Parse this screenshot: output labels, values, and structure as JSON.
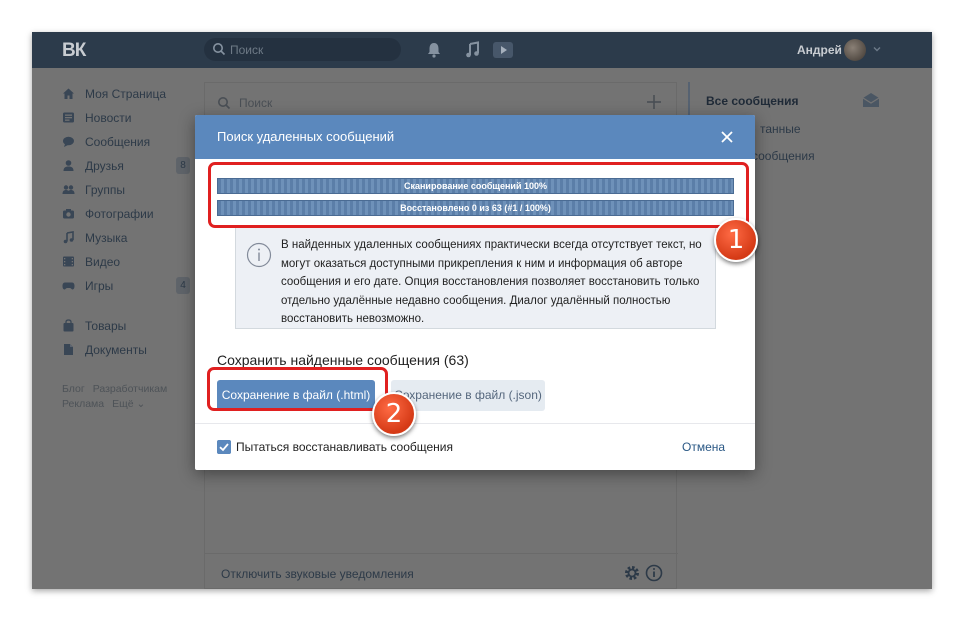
{
  "topbar": {
    "logo": "ВК",
    "search_placeholder": "Поиск",
    "user_name": "Андрей"
  },
  "sidebar": {
    "items": [
      {
        "label": "Моя Страница",
        "icon": "home-icon",
        "count": ""
      },
      {
        "label": "Новости",
        "icon": "news-icon",
        "count": ""
      },
      {
        "label": "Сообщения",
        "icon": "messages-icon",
        "count": ""
      },
      {
        "label": "Друзья",
        "icon": "friends-icon",
        "count": "8"
      },
      {
        "label": "Группы",
        "icon": "groups-icon",
        "count": ""
      },
      {
        "label": "Фотографии",
        "icon": "camera-icon",
        "count": ""
      },
      {
        "label": "Музыка",
        "icon": "music-icon",
        "count": ""
      },
      {
        "label": "Видео",
        "icon": "video-icon",
        "count": ""
      },
      {
        "label": "Игры",
        "icon": "gamepad-icon",
        "count": "4"
      }
    ],
    "items2": [
      {
        "label": "Товары",
        "icon": "bag-icon"
      },
      {
        "label": "Документы",
        "icon": "document-icon"
      }
    ],
    "footer": [
      "Блог",
      "Разработчикам",
      "Реклама",
      "Ещё ⌄"
    ]
  },
  "main": {
    "search_placeholder": "Поиск",
    "bottom_label": "Отключить звуковые уведомления"
  },
  "right": {
    "all_messages": "Все сообщения",
    "item2": "танные",
    "item3": "сообщения"
  },
  "modal": {
    "title": "Поиск удаленных сообщений",
    "progress_scan": "Сканирование сообщений 100%",
    "progress_restore": "Восстановлено 0 из 63 (#1 / 100%)",
    "info_text": "В найденных удаленных сообщениях практически всегда отсутствует текст, но могут оказаться доступными прикрепления к ним и информация об авторе сообщения и его дате. Опция восстановления позволяет восстановить только отдельно удалённые недавно сообщения. Диалог удалённый полностью восстановить невозможно.",
    "save_title": "Сохранить найденные сообщения (63)",
    "btn_html": "Сохранение в файл (.html)",
    "btn_json": "Сохранение в файл (.json)",
    "checkbox_label": "Пытаться восстанавливать сообщения",
    "cancel": "Отмена"
  },
  "annotations": {
    "badge_1": "1",
    "badge_2": "2"
  },
  "colors": {
    "header_blue": "#5b88bd",
    "highlight_red": "#e02020",
    "badge_orange": "#e8502a"
  }
}
